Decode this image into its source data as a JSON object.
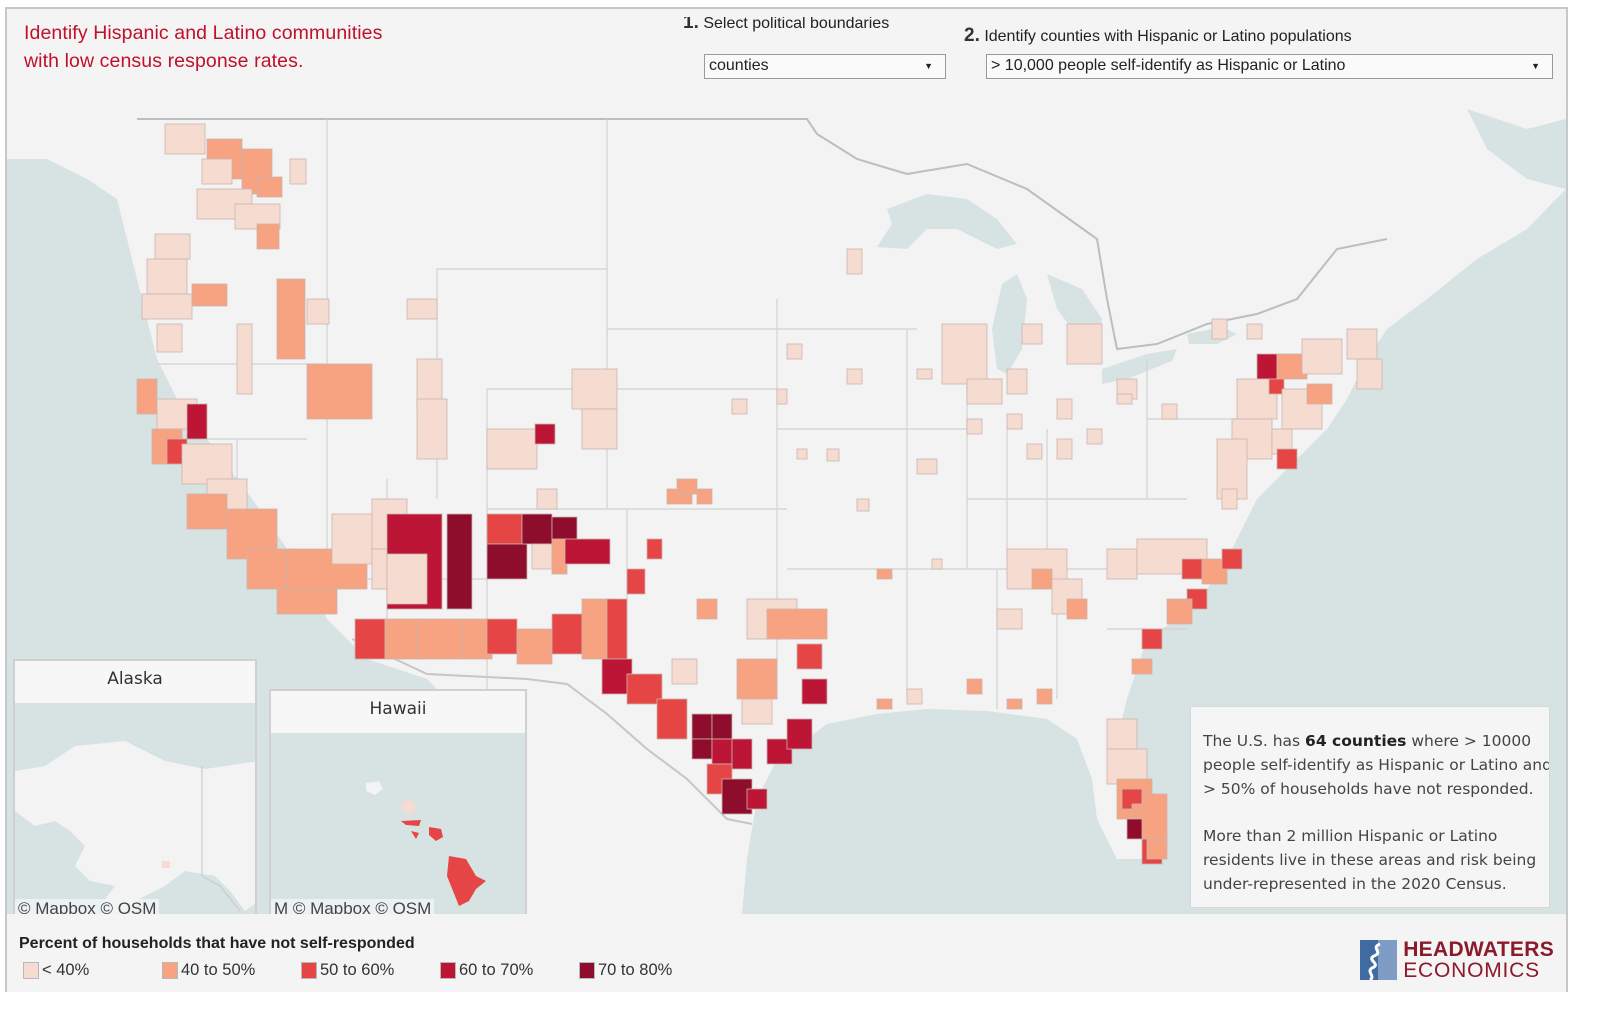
{
  "header": {
    "title_line1": "Identify Hispanic and Latino communities",
    "title_line2": "with low census response rates.",
    "step1_number": "1.",
    "step1_label": "Select political boundaries",
    "step1_value": "counties",
    "step2_number": "2.",
    "step2_label": "Identify counties with Hispanic or Latino populations",
    "step2_value": "> 10,000 people self-identify as Hispanic or Latino",
    "caret": "▼"
  },
  "map": {
    "attribution": "© Mapbox © OSM",
    "attribution_hawaii": "M © Mapbox © OSM",
    "insets": {
      "alaska": "Alaska",
      "hawaii": "Hawaii"
    },
    "colors": {
      "water": "#d7e2e2",
      "land": "#f3f3f3",
      "border": "#c9c9c9"
    }
  },
  "infobox": {
    "p1_pre": "The U.S. has ",
    "p1_bold": "64 counties",
    "p1_post1": " where > 10000",
    "p1_line2": "people self-identify as Hispanic or Latino and",
    "p1_line3": "> 50% of households have not responded.",
    "p2_line1": "More than 2 million Hispanic or Latino",
    "p2_line2": "residents live in these areas and risk being",
    "p2_line3": "under-represented in the 2020 Census."
  },
  "legend": {
    "title": "Percent of households that have not self-responded",
    "bins": [
      {
        "label": "< 40%",
        "color": "#f6dcd0"
      },
      {
        "label": "40 to 50%",
        "color": "#f7a382"
      },
      {
        "label": "50 to 60%",
        "color": "#e64545"
      },
      {
        "label": "60 to 70%",
        "color": "#bc1535"
      },
      {
        "label": "70 to 80%",
        "color": "#8e0c2c"
      }
    ]
  },
  "logo": {
    "line1": "HEADWATERS",
    "line2": "ECONOMICS"
  }
}
